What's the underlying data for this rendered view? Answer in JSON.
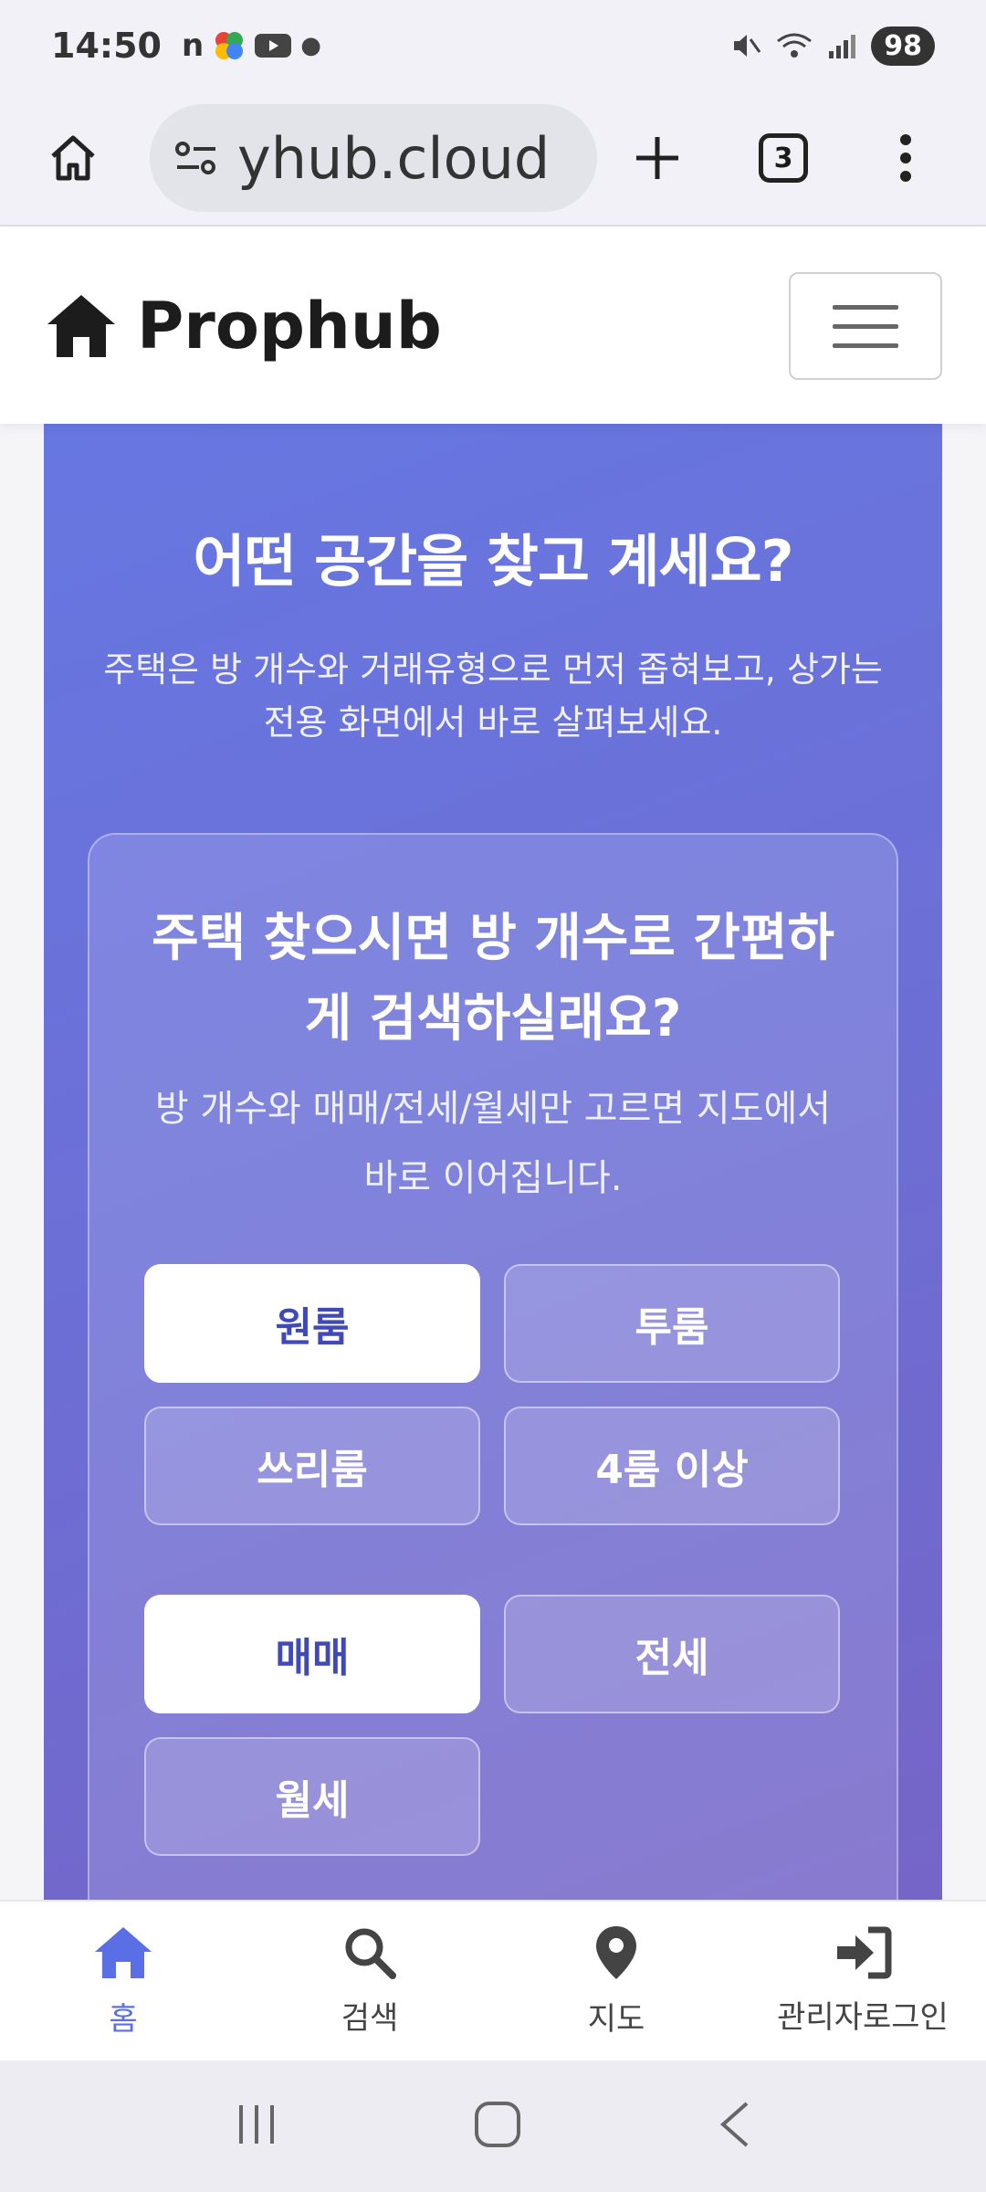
{
  "status_bar": {
    "time": "14:50",
    "app_icons": [
      "n-icon",
      "colorful-app-icon",
      "youtube-icon",
      "dot-icon"
    ],
    "battery": "98"
  },
  "browser": {
    "url": "yhub.cloud",
    "tab_count": "3"
  },
  "site": {
    "brand": "Prophub"
  },
  "hero": {
    "title": "어떤 공간을 찾고 계세요?",
    "subtitle": "주택은 방 개수와 거래유형으로 먼저 좁혀보고, 상가는 전용 화면에서 바로 살펴보세요."
  },
  "card": {
    "title": "주택 찾으시면 방 개수로 간편하게 검색하실래요?",
    "subtitle": "방 개수와 매매/전세/월세만 고르면 지도에서 바로 이어집니다.",
    "room_options": [
      {
        "label": "원룸",
        "selected": true
      },
      {
        "label": "투룸",
        "selected": false
      },
      {
        "label": "쓰리룸",
        "selected": false
      },
      {
        "label": "4룸 이상",
        "selected": false
      }
    ],
    "deal_options": [
      {
        "label": "매매",
        "selected": true
      },
      {
        "label": "전세",
        "selected": false
      },
      {
        "label": "월세",
        "selected": false
      }
    ]
  },
  "bottom_nav": {
    "items": [
      {
        "label": "홈",
        "icon": "home-icon",
        "active": true
      },
      {
        "label": "검색",
        "icon": "search-icon",
        "active": false
      },
      {
        "label": "지도",
        "icon": "map-pin-icon",
        "active": false
      },
      {
        "label": "관리자로그인",
        "icon": "login-icon",
        "active": false
      }
    ]
  },
  "colors": {
    "accent": "#5a6ee6",
    "hero_gradient_start": "#6777e2",
    "hero_gradient_end": "#7664c6",
    "selected_text": "#3f49b8"
  }
}
